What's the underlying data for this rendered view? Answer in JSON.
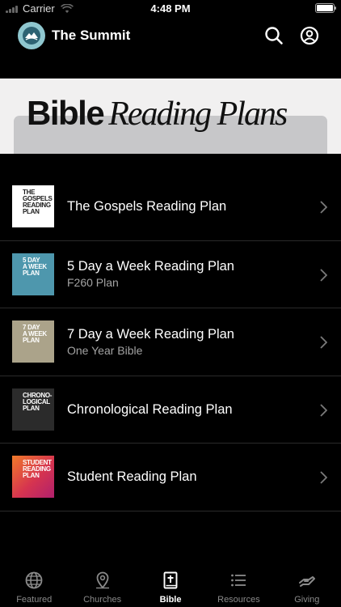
{
  "status_bar": {
    "carrier": "Carrier",
    "time": "4:48 PM"
  },
  "header": {
    "title": "The Summit",
    "icons": [
      "search-icon",
      "account-icon"
    ]
  },
  "banner": {
    "title_bold": "Bible",
    "title_script": "Reading Plans"
  },
  "plans": [
    {
      "title": "The Gospels Reading Plan",
      "subtitle": "",
      "thumb_lines": [
        "THE",
        "GOSPELS",
        "READING",
        "PLAN"
      ],
      "thumb_bg": "#ffffff",
      "thumb_fg": "#1a1a1a"
    },
    {
      "title": "5 Day a Week Reading Plan",
      "subtitle": "F260 Plan",
      "thumb_lines": [
        "5 DAY",
        "A WEEK",
        "PLAN"
      ],
      "thumb_bg": "#4e97ad",
      "thumb_fg": "#ffffff"
    },
    {
      "title": "7 Day a Week Reading Plan",
      "subtitle": "One Year Bible",
      "thumb_lines": [
        "7 DAY",
        "A WEEK",
        "PLAN"
      ],
      "thumb_bg": "#aba38a",
      "thumb_fg": "#ffffff"
    },
    {
      "title": "Chronological Reading Plan",
      "subtitle": "",
      "thumb_lines": [
        "CHRONO-",
        "LOGICAL",
        "PLAN"
      ],
      "thumb_bg": "#2b2b2b",
      "thumb_fg": "#ffffff"
    },
    {
      "title": "Student Reading Plan",
      "subtitle": "",
      "thumb_lines": [
        "STUDENT",
        "READING",
        "PLAN"
      ],
      "thumb_bg": "#d6344f",
      "thumb_fg": "#ffffff"
    }
  ],
  "tabs": [
    {
      "label": "Featured",
      "icon": "globe-icon",
      "active": false
    },
    {
      "label": "Churches",
      "icon": "location-pin-icon",
      "active": false
    },
    {
      "label": "Bible",
      "icon": "bible-icon",
      "active": true
    },
    {
      "label": "Resources",
      "icon": "list-icon",
      "active": false
    },
    {
      "label": "Giving",
      "icon": "giving-hand-icon",
      "active": false
    }
  ],
  "colors": {
    "background": "#000000",
    "banner_bg": "#f1f0f0",
    "muted_text": "#a3a3a3",
    "inactive_tab": "#8a8a8a"
  }
}
